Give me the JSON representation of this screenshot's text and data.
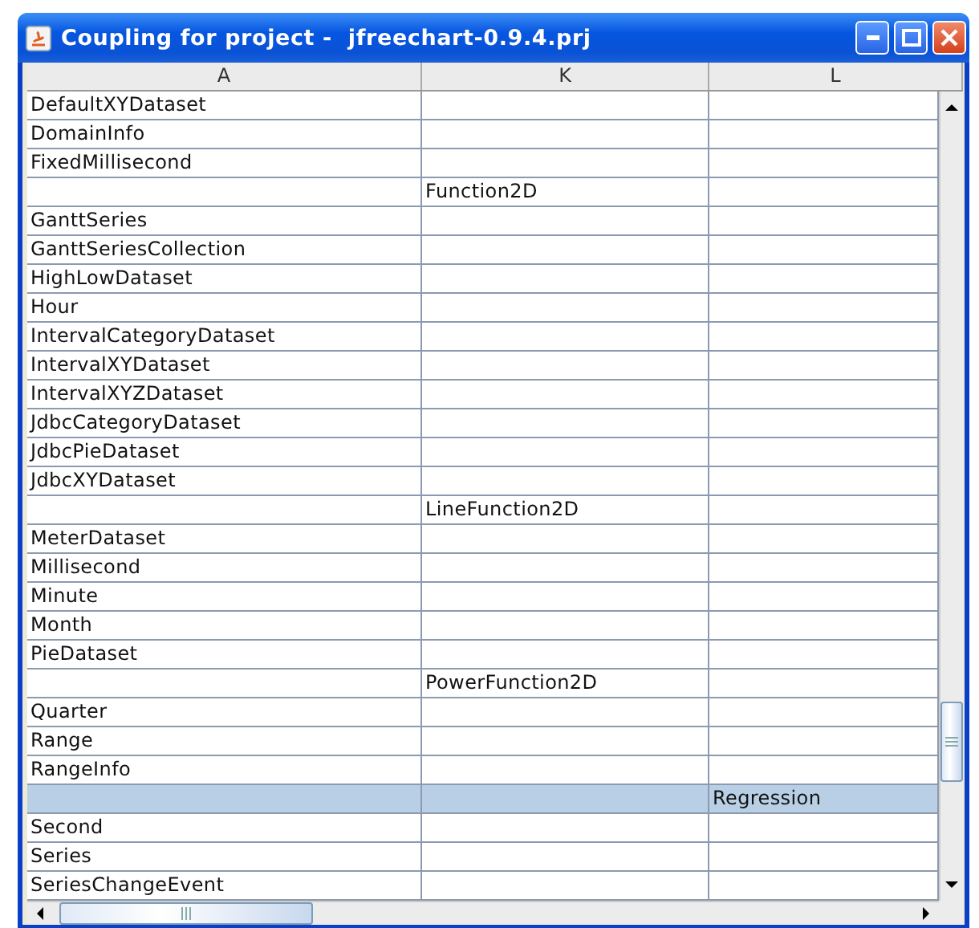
{
  "window": {
    "title": "Coupling for project -  jfreechart-0.9.4.prj"
  },
  "table": {
    "columns": [
      "A",
      "K",
      "L"
    ],
    "rows": [
      {
        "cells": [
          "DefaultXYDataset",
          "",
          ""
        ],
        "selected": false
      },
      {
        "cells": [
          "DomainInfo",
          "",
          ""
        ],
        "selected": false
      },
      {
        "cells": [
          "FixedMillisecond",
          "",
          ""
        ],
        "selected": false
      },
      {
        "cells": [
          "",
          "Function2D",
          ""
        ],
        "selected": false
      },
      {
        "cells": [
          "GanttSeries",
          "",
          ""
        ],
        "selected": false
      },
      {
        "cells": [
          "GanttSeriesCollection",
          "",
          ""
        ],
        "selected": false
      },
      {
        "cells": [
          "HighLowDataset",
          "",
          ""
        ],
        "selected": false
      },
      {
        "cells": [
          "Hour",
          "",
          ""
        ],
        "selected": false
      },
      {
        "cells": [
          "IntervalCategoryDataset",
          "",
          ""
        ],
        "selected": false
      },
      {
        "cells": [
          "IntervalXYDataset",
          "",
          ""
        ],
        "selected": false
      },
      {
        "cells": [
          "IntervalXYZDataset",
          "",
          ""
        ],
        "selected": false
      },
      {
        "cells": [
          "JdbcCategoryDataset",
          "",
          ""
        ],
        "selected": false
      },
      {
        "cells": [
          "JdbcPieDataset",
          "",
          ""
        ],
        "selected": false
      },
      {
        "cells": [
          "JdbcXYDataset",
          "",
          ""
        ],
        "selected": false
      },
      {
        "cells": [
          "",
          "LineFunction2D",
          ""
        ],
        "selected": false
      },
      {
        "cells": [
          "MeterDataset",
          "",
          ""
        ],
        "selected": false
      },
      {
        "cells": [
          "Millisecond",
          "",
          ""
        ],
        "selected": false
      },
      {
        "cells": [
          "Minute",
          "",
          ""
        ],
        "selected": false
      },
      {
        "cells": [
          "Month",
          "",
          ""
        ],
        "selected": false
      },
      {
        "cells": [
          "PieDataset",
          "",
          ""
        ],
        "selected": false
      },
      {
        "cells": [
          "",
          "PowerFunction2D",
          ""
        ],
        "selected": false
      },
      {
        "cells": [
          "Quarter",
          "",
          ""
        ],
        "selected": false
      },
      {
        "cells": [
          "Range",
          "",
          ""
        ],
        "selected": false
      },
      {
        "cells": [
          "RangeInfo",
          "",
          ""
        ],
        "selected": false
      },
      {
        "cells": [
          "",
          "",
          "Regression"
        ],
        "selected": true
      },
      {
        "cells": [
          "Second",
          "",
          ""
        ],
        "selected": false
      },
      {
        "cells": [
          "Series",
          "",
          ""
        ],
        "selected": false
      },
      {
        "cells": [
          "SeriesChangeEvent",
          "",
          ""
        ],
        "selected": false
      }
    ]
  }
}
